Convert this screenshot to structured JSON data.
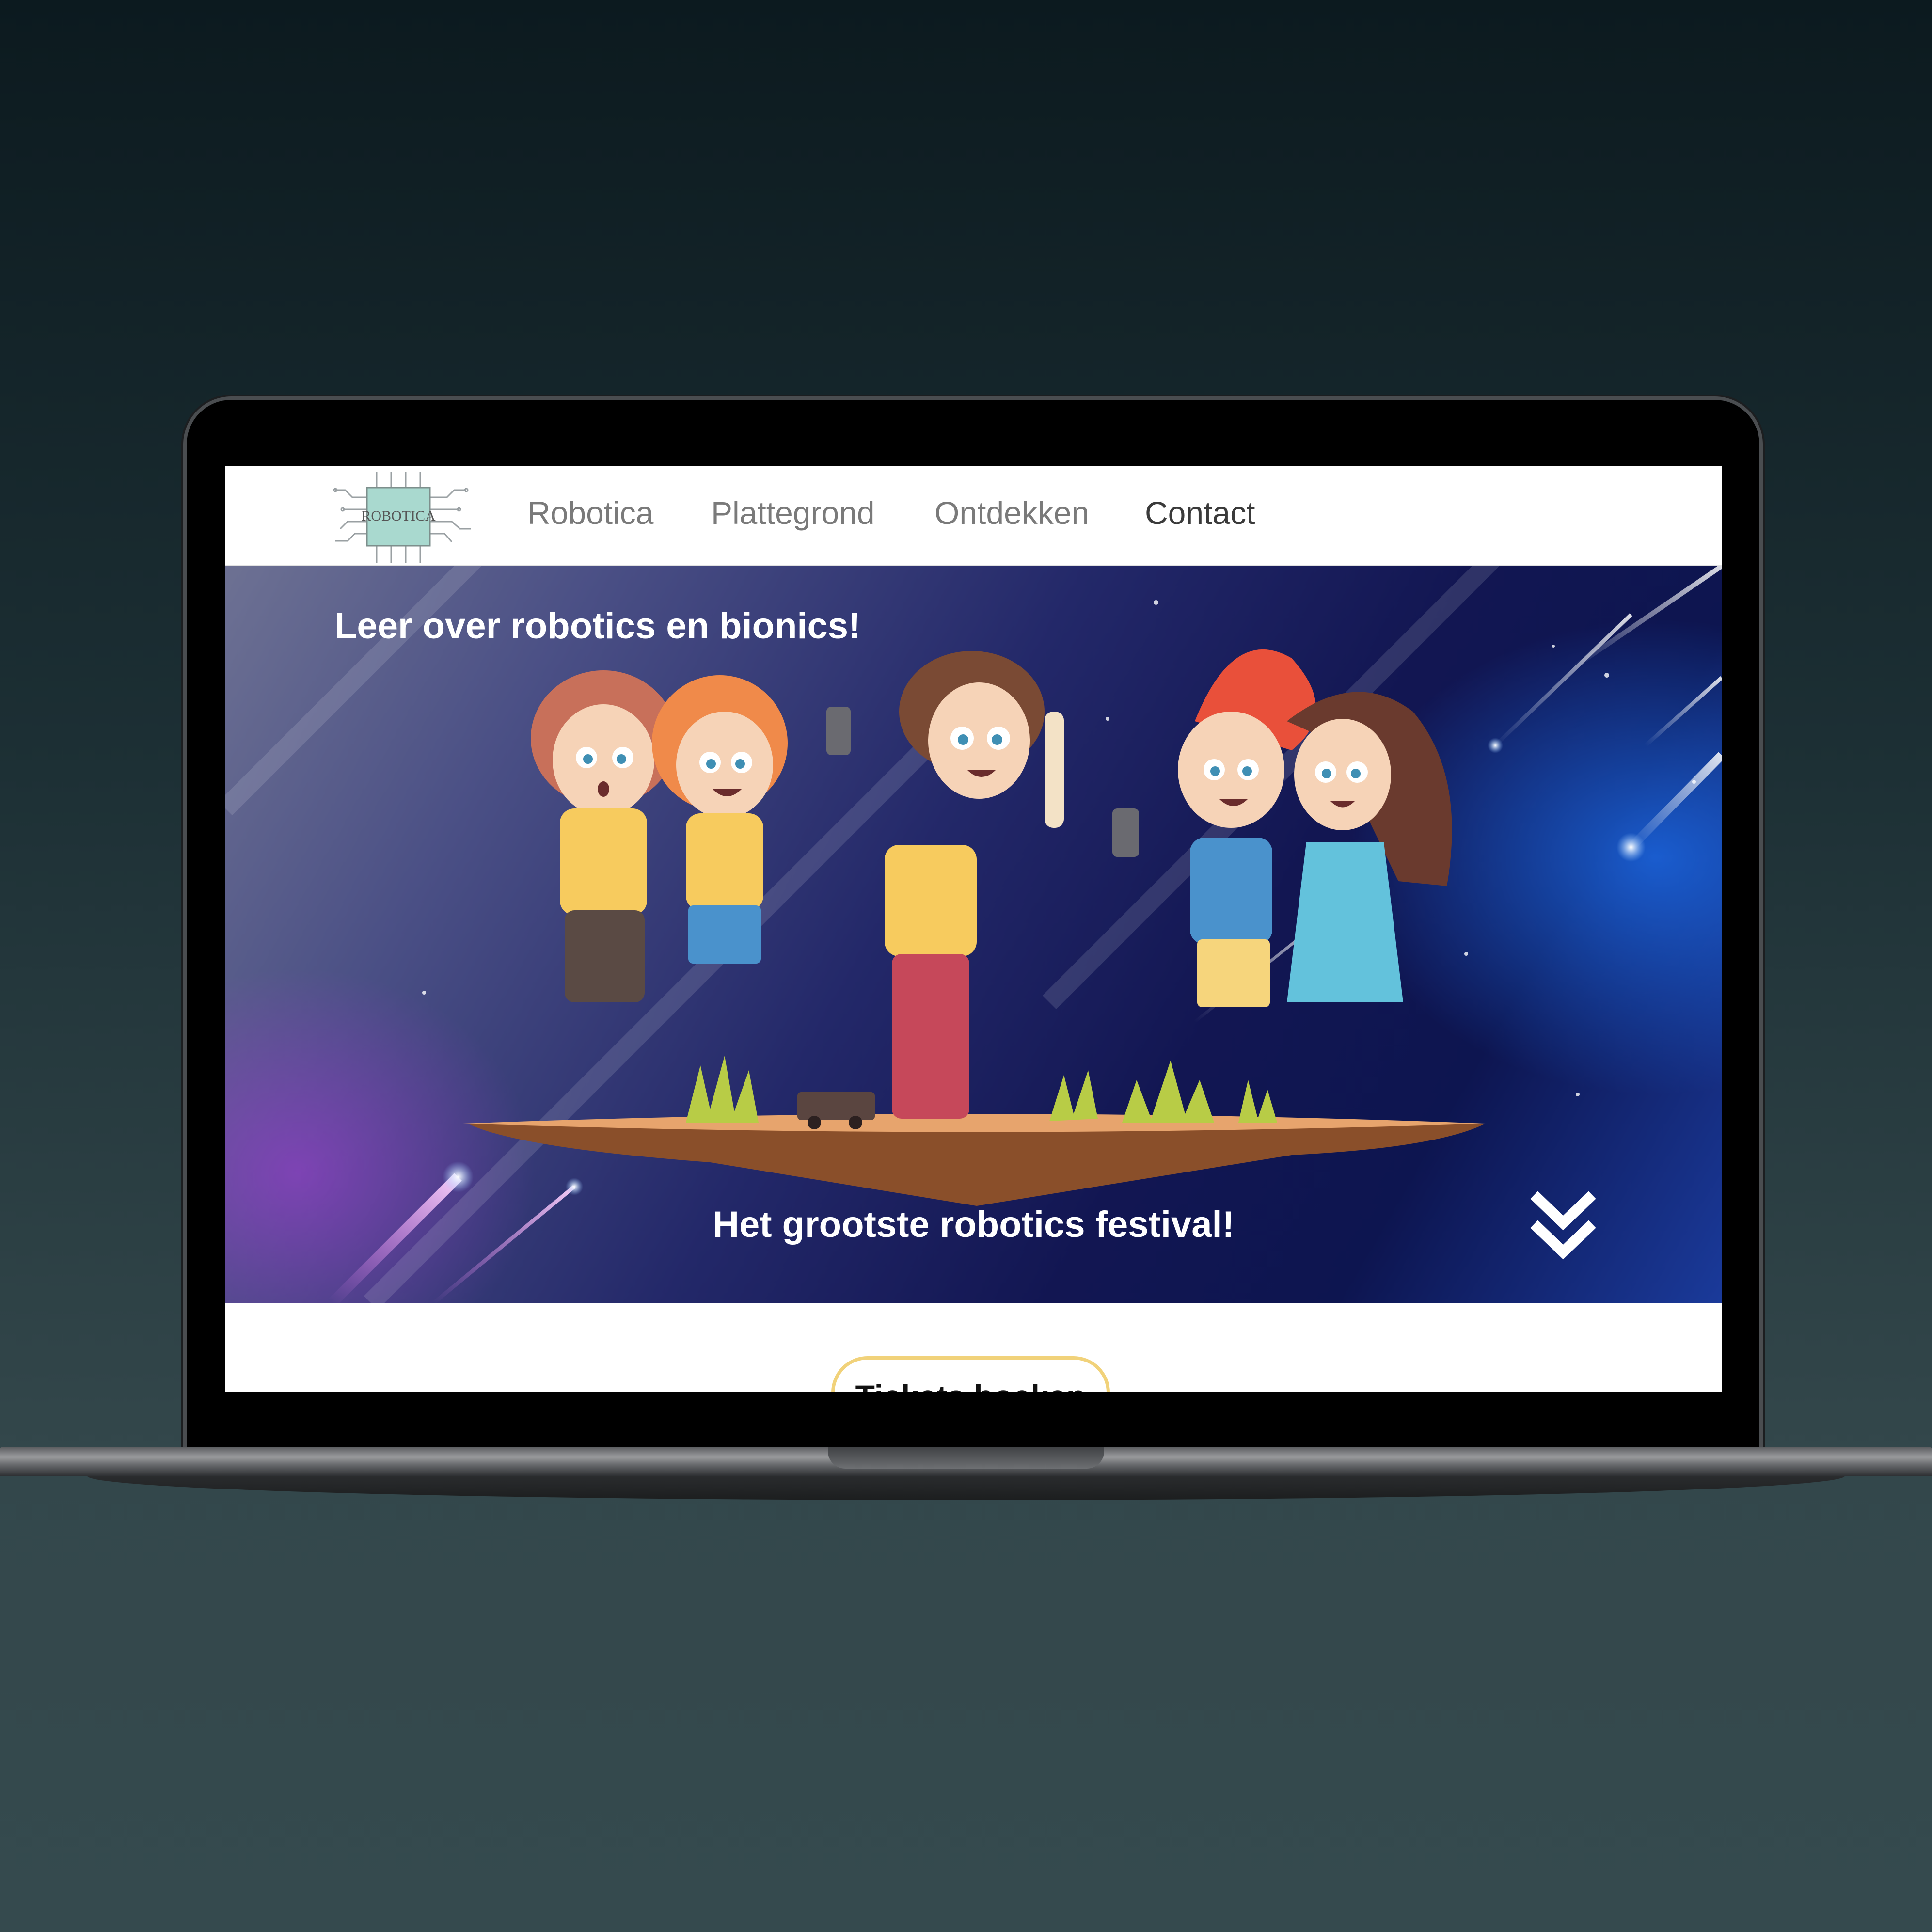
{
  "nav": {
    "logo_text": "ROBOTICA",
    "links": [
      {
        "label": "Robotica"
      },
      {
        "label": "Plattegrond"
      },
      {
        "label": "Ontdekken"
      },
      {
        "label": "Contact"
      }
    ]
  },
  "hero": {
    "headline": "Leer over robotics en bionics!",
    "subheadline": "Het grootste robotics festival!"
  },
  "cta": {
    "tickets_label": "Tickets boeken"
  },
  "colors": {
    "logo_chip": "#a9d9cf",
    "cta_border": "#f1d27a",
    "hero_dark": "#121652"
  },
  "icons": [
    "chip-logo",
    "double-chevron-down-icon"
  ]
}
